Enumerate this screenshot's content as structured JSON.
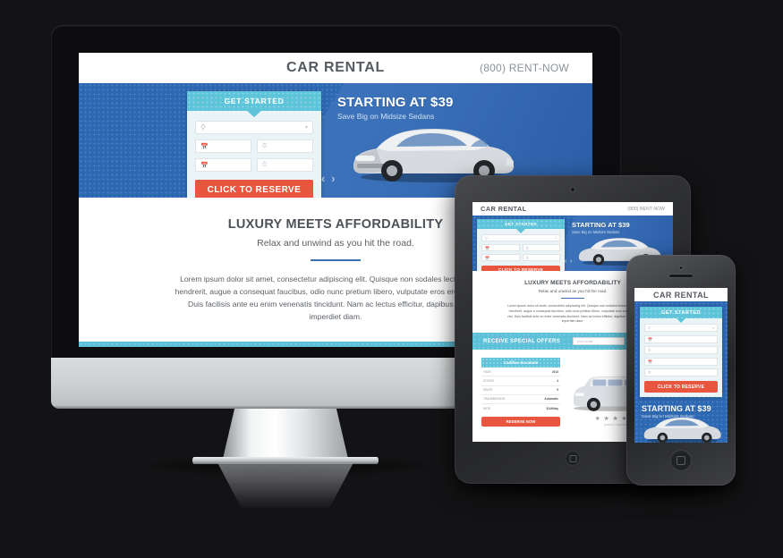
{
  "site": {
    "logo": "CAR RENTAL",
    "phone": "(800) RENT-NOW"
  },
  "booking": {
    "heading": "GET STARTED",
    "fields": [
      {
        "icon": "location-pin-icon",
        "value": "",
        "placeholder": "",
        "caret": "▾"
      },
      {
        "icon": "calendar-icon",
        "value": "",
        "placeholder": ""
      },
      {
        "icon": "clock-icon",
        "value": "",
        "placeholder": ""
      },
      {
        "icon": "calendar-icon",
        "value": "",
        "placeholder": ""
      },
      {
        "icon": "clock-icon",
        "value": "",
        "placeholder": ""
      }
    ],
    "cta": "CLICK TO RESERVE"
  },
  "hero": {
    "headline": "STARTING AT $39",
    "subline": "Save Big on Midsize Sedans",
    "prev_arrow": "‹",
    "next_arrow": "›",
    "car_alt": "silver-sedan",
    "bg_color": "#2d68b2"
  },
  "section": {
    "heading": "LUXURY MEETS AFFORDABILITY",
    "subheading": "Relax and unwind as you hit the road.",
    "body": "Lorem ipsum dolor sit amet, consectetur adipiscing elit. Quisque non sodales lectus. Mauris hendrerit, augue a consequat faucibus, odio nunc pretium libero, vulputate eros eros vitae nisi. Duis facilisis ante eu enim venenatis tincidunt. Nam ac lectus efficitur, dapibus eros eu, imperdiet diam."
  },
  "offers": {
    "heading": "RECEIVE SPECIAL OFFERS",
    "email_placeholder": "your email"
  },
  "listing": {
    "title": "Cadillac Escalade",
    "specs": [
      {
        "label": "YEAR",
        "value": "2013"
      },
      {
        "label": "DOORS",
        "value": "4"
      },
      {
        "label": "SEATS",
        "value": "5"
      },
      {
        "label": "TRANSMISSION",
        "value": "Automatic"
      },
      {
        "label": "RATE",
        "value": "$149/day"
      }
    ],
    "cta": "RESERVE NOW",
    "stars": "★ ★ ★ ★ ★",
    "stars_label": "SAFETY RATING",
    "car_alt": "silver-suv"
  },
  "colors": {
    "brand_blue": "#2d68b2",
    "teal": "#5bc0d8",
    "cta_red": "#e8563f",
    "heading_gray": "#4c5258",
    "page_bg": "#131315"
  }
}
